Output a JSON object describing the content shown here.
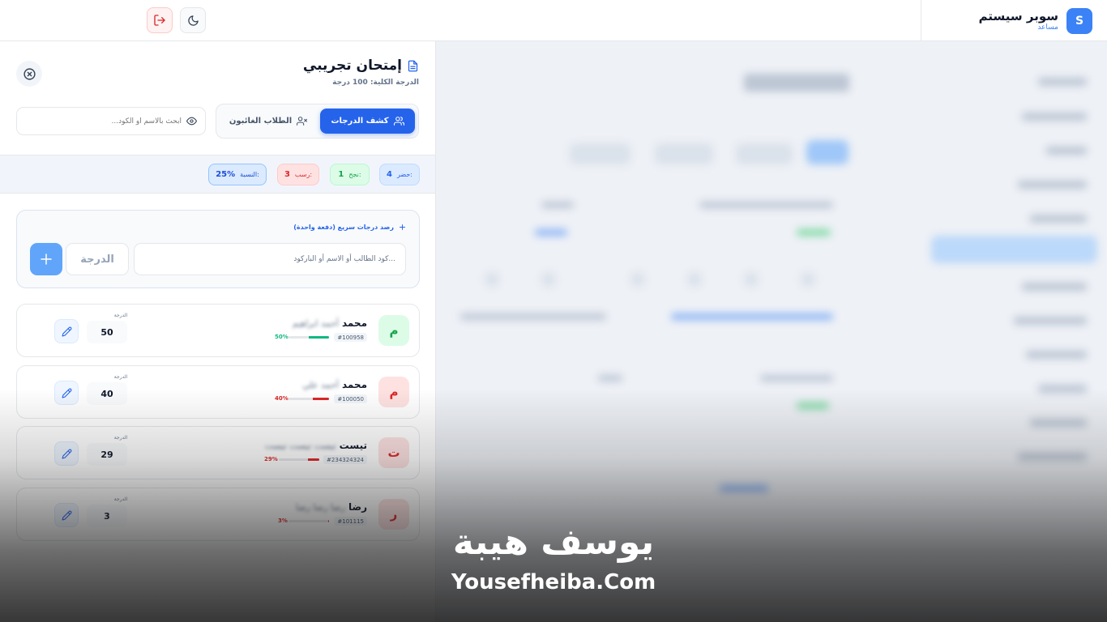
{
  "brand": {
    "title": "سوبر سيستم",
    "subtitle": "مساعد",
    "logo_letter": "S"
  },
  "topbar": {
    "logout_icon": "logout-icon",
    "theme_icon": "moon-icon"
  },
  "exam": {
    "title": "إمتحان تجريبي",
    "subtitle": "الدرجة الكلية: 100 درجة",
    "tabs": [
      {
        "label": "كشف الدرجات",
        "icon": "users-icon",
        "active": true
      },
      {
        "label": "الطلاب الغائبون",
        "icon": "user-x-icon",
        "active": false
      }
    ],
    "search_placeholder": "ابحث بالاسم أو الكود..."
  },
  "stats": {
    "present_label": "حضر:",
    "present_value": "4",
    "pass_label": "نجح:",
    "pass_value": "1",
    "fail_label": "رسب:",
    "fail_value": "3",
    "ratio_label": "النسبة:",
    "ratio_value": "25%"
  },
  "quick_entry": {
    "title": "رصد درجات سريع (دفعة واحدة)",
    "code_placeholder": "كود الطالب أو الاسم أو الباركود...",
    "grade_placeholder": "الدرجة",
    "add_label": "+"
  },
  "grade_label": "الدرجة",
  "students": [
    {
      "initial": "م",
      "first_name": "محمد",
      "rest_name": "أحمد ابراهيم",
      "code": "#100958",
      "percent": "50%",
      "progress": 0.5,
      "grade": "50",
      "status": "pass"
    },
    {
      "initial": "م",
      "first_name": "محمد",
      "rest_name": "أحمد علي",
      "code": "#100050",
      "percent": "40%",
      "progress": 0.4,
      "grade": "40",
      "status": "fail"
    },
    {
      "initial": "ت",
      "first_name": "تيست",
      "rest_name": "تيست تيست تيست",
      "code": "#234324324",
      "percent": "29%",
      "progress": 0.29,
      "grade": "29",
      "status": "fail"
    },
    {
      "initial": "ر",
      "first_name": "رضا",
      "rest_name": "رضا رضا رضا",
      "code": "#101115",
      "percent": "3%",
      "progress": 0.03,
      "grade": "3",
      "status": "fail"
    }
  ],
  "watermark": {
    "arabic": "يوسف هيبة",
    "english": "Yousefheiba.Com"
  },
  "colors": {
    "primary": "#2563eb",
    "pass": "#10b981",
    "fail": "#dc2626"
  }
}
